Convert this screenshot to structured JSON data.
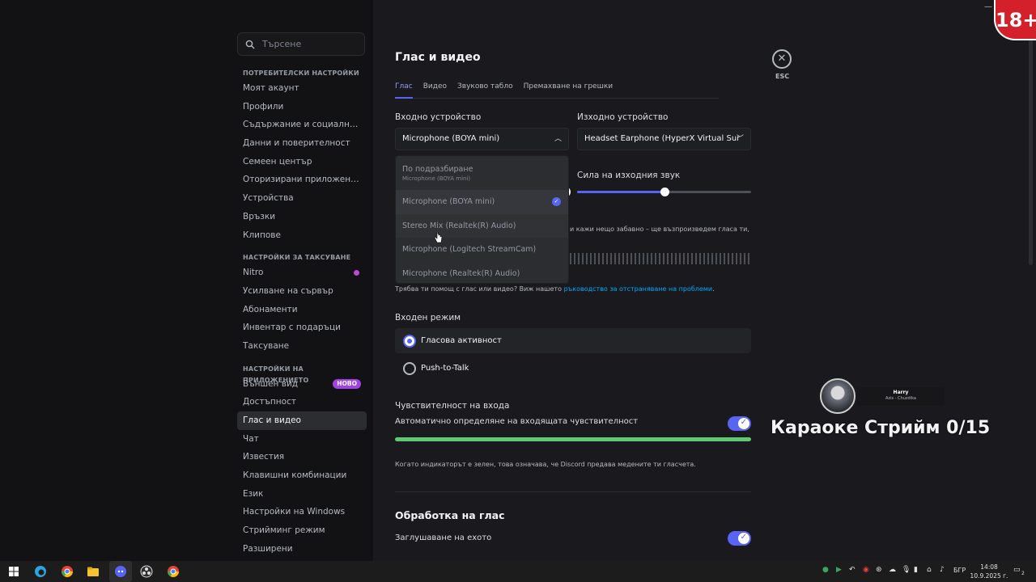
{
  "search": {
    "placeholder": "Търсене"
  },
  "sidebar": {
    "sections": [
      {
        "header": "ПОТРЕБИТЕЛСКИ НАСТРОЙКИ",
        "items": [
          "Моят акаунт",
          "Профили",
          "Съдържание и социални мре...",
          "Данни и поверителност",
          "Семеен център",
          "Оторизирани приложения",
          "Устройства",
          "Връзки",
          "Клипове"
        ]
      },
      {
        "header": "НАСТРОЙКИ ЗА ТАКСУВАНЕ",
        "items": [
          "Nitro",
          "Усилване на сървър",
          "Абонаменти",
          "Инвентар с подаръци",
          "Таксуване"
        ]
      },
      {
        "header": "НАСТРОЙКИ НА ПРИЛОЖЕНИЕТО",
        "items": [
          "Външен вид",
          "Достъпност",
          "Глас и видео",
          "Чат",
          "Известия",
          "Клавишни комбинации",
          "Език",
          "Настройки на Windows",
          "Стрийминг режим",
          "Разширени"
        ]
      }
    ],
    "new_badge": "НОВО",
    "active_item": "Глас и видео"
  },
  "page": {
    "title": "Глас и видео",
    "tabs": [
      "Глас",
      "Видео",
      "Звуково табло",
      "Премахване на грешки"
    ],
    "input_device_label": "Входно устройство",
    "input_device_value": "Microphone (BOYA mini)",
    "output_device_label": "Изходно устройство",
    "output_device_value": "Headset Earphone (HyperX Virtual Sur",
    "output_volume_label": "Сила на изходния звук",
    "output_volume_fraction": 0.5,
    "mic_test_partial": "и кажи нещо забавно – ще възпроизведем гласа ти,",
    "help_text": "Трябва ти помощ с глас или видео? Виж нашето ",
    "help_link": "ръководство за отстраняване на проблеми",
    "help_end": ".",
    "input_mode_label": "Входен режим",
    "input_mode_voice": "Гласова активност",
    "input_mode_ptt": "Push-to-Talk",
    "sensitivity_label": "Чувствителност на входа",
    "auto_sensitivity_label": "Автоматично определяне на входящата чувствителност",
    "sensitivity_hint": "Когато индикаторът е зелен, това означава, че Discord предава медените ти гласчета.",
    "voice_processing_title": "Обработка на глас",
    "echo_cancel_label": "Заглушаване на ехото"
  },
  "dropdown": {
    "options": [
      {
        "label": "По подразбиране",
        "sub": "Microphone (BOYA mini)"
      },
      {
        "label": "Microphone (BOYA mini)",
        "selected": true
      },
      {
        "label": "Stereo Mix (Realtek(R) Audio)"
      },
      {
        "label": "Microphone (Logitech StreamCam)"
      },
      {
        "label": "Microphone (Realtek(R) Audio)"
      }
    ]
  },
  "esc_label": "ESC",
  "age_badge": "18+",
  "overlay": {
    "karaoke": "Караоке Стрийм 0/15",
    "music_title": "Harry",
    "music_artist": "Azis - Chuzdika"
  },
  "taskbar": {
    "lang": "БГР",
    "time": "14:08",
    "date": "10.9.2025 г.",
    "notif_count": "2"
  }
}
